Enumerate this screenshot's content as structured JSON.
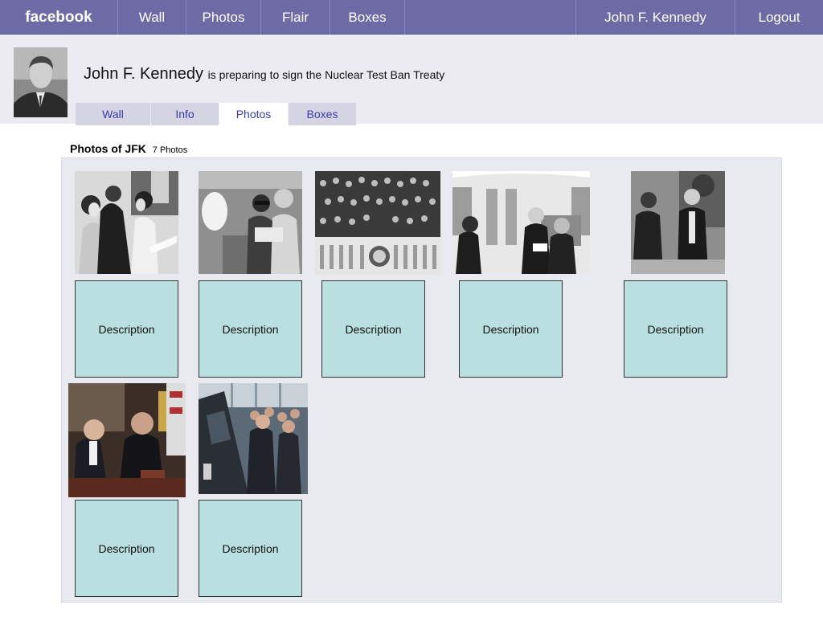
{
  "app": {
    "brand": "facebook"
  },
  "topnav": {
    "items": [
      "Wall",
      "Photos",
      "Flair",
      "Boxes"
    ],
    "user_name": "John F. Kennedy",
    "logout": "Logout"
  },
  "profile": {
    "name": "John F. Kennedy",
    "status": "is preparing to sign the Nuclear Test Ban Treaty",
    "tabs": [
      "Wall",
      "Info",
      "Photos",
      "Boxes"
    ],
    "active_tab": "Photos"
  },
  "photos": {
    "title": "Photos of JFK",
    "count": "7 Photos",
    "items": [
      {
        "description": "Description"
      },
      {
        "description": "Description"
      },
      {
        "description": "Description"
      },
      {
        "description": "Description"
      },
      {
        "description": "Description"
      },
      {
        "description": "Description"
      },
      {
        "description": "Description"
      }
    ]
  },
  "colors": {
    "topbar": "#6d6aa6",
    "description_box": "#b9dfe1",
    "tab_link": "#3b3bb0"
  }
}
